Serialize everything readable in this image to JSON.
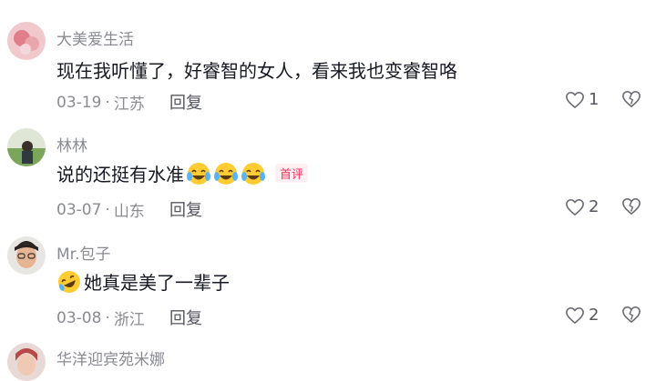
{
  "comments": [
    {
      "user": "大美爱生活",
      "text": "现在我听懂了，好睿智的女人，看来我也变睿智咯",
      "date": "03-19",
      "location": "江苏",
      "reply_label": "回复",
      "likes": "1",
      "avatar_color": "#e9a7ad"
    },
    {
      "user": "林林",
      "text": "说的还挺有水准",
      "emoji": [
        "laughing-crying-emoji",
        "laughing-crying-emoji",
        "laughing-crying-emoji"
      ],
      "badge": "首评",
      "date": "03-07",
      "location": "山东",
      "reply_label": "回复",
      "likes": "2",
      "avatar_color": "#7aa55b"
    },
    {
      "user": "Mr.包子",
      "text": "她真是美了一辈子",
      "emoji_prefix": "rolling-laughing-emoji",
      "date": "03-08",
      "location": "浙江",
      "reply_label": "回复",
      "likes": "2",
      "avatar_color": "#d9a27a"
    },
    {
      "user": "华洋迎宾苑米娜",
      "avatar_color": "#c98d8d"
    }
  ],
  "colors": {
    "username": "#8a8b91",
    "text": "#161823",
    "badge": "#fe2c55"
  }
}
